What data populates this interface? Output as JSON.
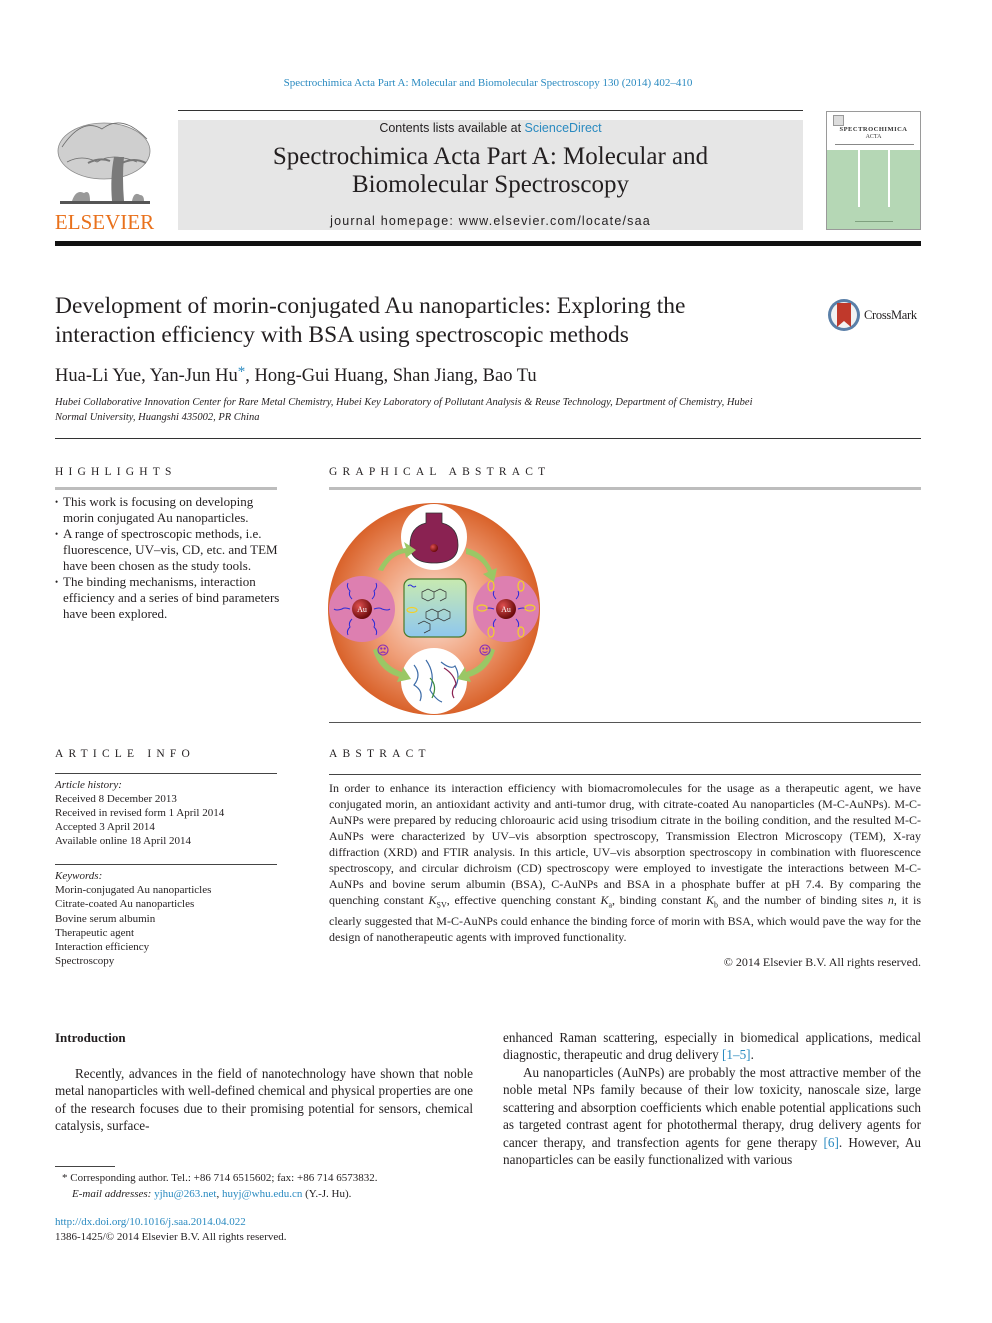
{
  "citation": "Spectrochimica Acta Part A: Molecular and Biomolecular Spectroscopy 130 (2014) 402–410",
  "header": {
    "publisher_logo": "ELSEVIER",
    "contents_prefix": "Contents lists available at ",
    "contents_link": "ScienceDirect",
    "journal_title_line1": "Spectrochimica Acta Part A: Molecular and",
    "journal_title_line2": "Biomolecular Spectroscopy",
    "homepage": "journal homepage: www.elsevier.com/locate/saa",
    "cover_title1": "SPECTROCHIMICA",
    "cover_title2": "ACTA",
    "colors": {
      "link": "#2a8ac0",
      "elsevier_orange": "#e9711c",
      "cover_green": "#b5d7b5",
      "header_bg": "#e6e6e6"
    }
  },
  "article": {
    "title_line1": "Development of morin-conjugated Au nanoparticles: Exploring the",
    "title_line2": "interaction efficiency with BSA using spectroscopic methods",
    "crossmark_label": "CrossMark",
    "authors_part1": "Hua-Li Yue, Yan-Jun Hu",
    "authors_star": "*",
    "authors_part2": ", Hong-Gui Huang, Shan Jiang, Bao Tu",
    "affiliation_line1": "Hubei Collaborative Innovation Center for Rare Metal Chemistry, Hubei Key Laboratory of Pollutant Analysis & Reuse Technology, Department of Chemistry, Hubei",
    "affiliation_line2": "Normal University, Huangshi 435002, PR China"
  },
  "highlights": {
    "heading": "HIGHLIGHTS",
    "items": [
      "This work is focusing on developing morin conjugated Au nanoparticles.",
      "A range of spectroscopic methods, i.e. fluorescence, UV–vis, CD, etc. and TEM have been chosen as the study tools.",
      "The binding mechanisms, interaction efficiency and a series of bind parameters have been explored."
    ]
  },
  "graphical_abstract": {
    "heading": "GRAPHICAL ABSTRACT",
    "figure_labels": {
      "left_particle": "Au",
      "right_particle": "Au"
    }
  },
  "article_info": {
    "heading": "ARTICLE INFO",
    "history_label": "Article history:",
    "history": [
      "Received 8 December 2013",
      "Received in revised form 1 April 2014",
      "Accepted 3 April 2014",
      "Available online 18 April 2014"
    ],
    "keywords_label": "Keywords:",
    "keywords": [
      "Morin-conjugated Au nanoparticles",
      "Citrate-coated Au nanoparticles",
      "Bovine serum albumin",
      "Therapeutic agent",
      "Interaction efficiency",
      "Spectroscopy"
    ]
  },
  "abstract": {
    "heading": "ABSTRACT",
    "text_a": "In order to enhance its interaction efficiency with biomacromolecules for the usage as a therapeutic agent, we have conjugated morin, an antioxidant activity and anti-tumor drug, with citrate-coated Au nanoparticles (M-C-AuNPs). M-C-AuNPs were prepared by reducing chloroauric acid using trisodium citrate in the boiling condition, and the resulted M-C-AuNPs were characterized by UV–vis absorption spectroscopy, Transmission Electron Microscopy (TEM), X-ray diffraction (XRD) and FTIR analysis. In this article, UV–vis absorption spectroscopy in combination with fluorescence spectroscopy, and circular dichroism (CD) spectroscopy were employed to investigate the interactions between M-C-AuNPs and bovine serum albumin (BSA), C-AuNPs and BSA in a phosphate buffer at pH 7.4. By comparing the quenching constant ",
    "ksv_main": "K",
    "ksv_sub": "SV",
    "text_b": ", effective quenching constant ",
    "ka_main": "K",
    "ka_sub": "a",
    "text_c": ", binding constant ",
    "kb_main": "K",
    "kb_sub": "b",
    "text_d": " and the number of binding sites ",
    "n_var": "n",
    "text_e": ", it is clearly suggested that M-C-AuNPs could enhance the binding force of morin with BSA, which would pave the way for the design of nanotherapeutic agents with improved functionality.",
    "copyright": "© 2014 Elsevier B.V. All rights reserved."
  },
  "body": {
    "intro_heading": "Introduction",
    "left_para": "Recently, advances in the field of nanotechnology have shown that noble metal nanoparticles with well-defined chemical and physical properties are one of the research focuses due to their promising potential for sensors, chemical catalysis, surface-",
    "right_p1_text": "enhanced Raman scattering, especially in biomedical applications, medical diagnostic, therapeutic and drug delivery ",
    "right_p1_ref": "[1–5]",
    "right_p1_end": ".",
    "right_p2_text": "Au nanoparticles (AuNPs) are probably the most attractive member of the noble metal NPs family because of their low toxicity, nanoscale size, large scattering and absorption coefficients which enable potential applications such as targeted contrast agent for photothermal therapy, drug delivery agents for cancer therapy, and transfection agents for gene therapy ",
    "right_p2_ref": "[6]",
    "right_p2_end": ". However, Au nanoparticles can be easily functionalized with various"
  },
  "footnote": {
    "star": "*",
    "corresponding": "Corresponding author. Tel.: +86 714 6515602; fax: +86 714 6573832.",
    "email_label": "E-mail addresses:",
    "email1": "yjhu@263.net",
    "sep": ", ",
    "email2": "huyj@whu.edu.cn",
    "email_owner": " (Y.-J. Hu).",
    "doi": "http://dx.doi.org/10.1016/j.saa.2014.04.022",
    "issn": "1386-1425/© 2014 Elsevier B.V. All rights reserved."
  }
}
